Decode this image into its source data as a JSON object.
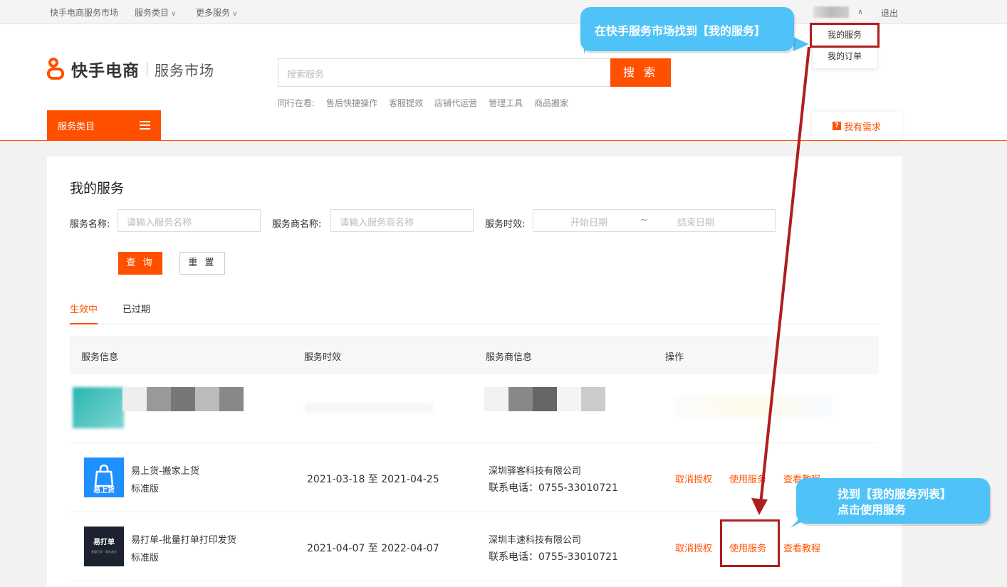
{
  "topbar": {
    "links": [
      "快手电商服务市场",
      "服务类目",
      "更多服务"
    ],
    "logout": "退出"
  },
  "dropdown": {
    "items": [
      "我的服务",
      "我的订单"
    ]
  },
  "header": {
    "brand": "快手电商",
    "sub": "服务市场",
    "search_placeholder": "搜索服务",
    "search_button": "搜 索",
    "hot_label": "同行在看:",
    "hot_items": [
      "售后快捷操作",
      "客服提效",
      "店铺代运营",
      "管理工具",
      "商品搬家"
    ],
    "category_button": "服务类目",
    "need_label": "我有需求",
    "need_badge": "?"
  },
  "page": {
    "title": "我的服务",
    "filters": {
      "service_name_label": "服务名称:",
      "service_name_placeholder": "请输入服务名称",
      "provider_label": "服务商名称:",
      "provider_placeholder": "请输入服务商名称",
      "validity_label": "服务时效:",
      "start_placeholder": "开始日期",
      "tilde": "~",
      "end_placeholder": "结束日期"
    },
    "query_button": "查 询",
    "reset_button": "重 置",
    "tabs": [
      "生效中",
      "已过期"
    ],
    "columns": [
      "服务信息",
      "服务时效",
      "服务商信息",
      "操作"
    ],
    "rows": [
      {
        "icon_text": "易上货",
        "name": "易上货-搬家上货",
        "version": "标准版",
        "period": "2021-03-18 至 2021-04-25",
        "company": "深圳驿客科技有限公司",
        "phone": "联系电话：0755-33010721",
        "actions": [
          "取消授权",
          "使用服务",
          "查看教程"
        ]
      },
      {
        "icon_text": "易打单",
        "icon_subtext": "批量打印 · 同步发货",
        "name": "易打单-批量打单打印发货",
        "version": "标准版",
        "period": "2021-04-07 至 2022-04-07",
        "company": "深圳丰速科技有限公司",
        "phone": "联系电话：0755-33010721",
        "actions": [
          "取消授权",
          "使用服务",
          "查看教程"
        ]
      }
    ]
  },
  "annotations": {
    "bubble_top": "在快手服务市场找到【我的服务】",
    "bubble_bottom_line1": "找到【我的服务列表】",
    "bubble_bottom_line2": "点击使用服务"
  },
  "colors": {
    "accent": "#ff5000",
    "highlight": "#b01e1e",
    "bubble": "#4fc3f7"
  }
}
